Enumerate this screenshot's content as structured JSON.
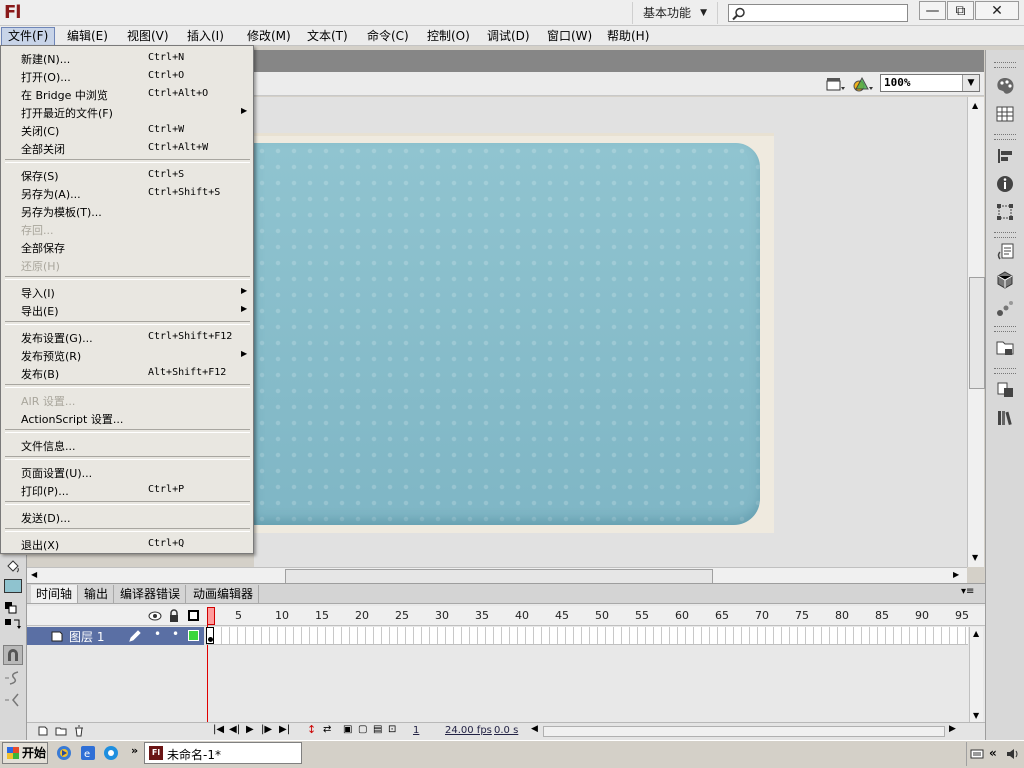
{
  "app": {
    "logo": "Fl",
    "workspace": "基本功能",
    "search": {
      "placeholder": ""
    },
    "window_buttons": {
      "minimize": "—",
      "restore": "⧉",
      "close": "✕"
    }
  },
  "menubar": [
    "文件(F)",
    "编辑(E)",
    "视图(V)",
    "插入(I)",
    "修改(M)",
    "文本(T)",
    "命令(C)",
    "控制(O)",
    "调试(D)",
    "窗口(W)",
    "帮助(H)"
  ],
  "file_menu": [
    {
      "label": "新建(N)...",
      "shortcut": "Ctrl+N"
    },
    {
      "label": "打开(O)...",
      "shortcut": "Ctrl+O"
    },
    {
      "label": "在 Bridge 中浏览",
      "shortcut": "Ctrl+Alt+O"
    },
    {
      "label": "打开最近的文件(F)",
      "submenu": true
    },
    {
      "label": "关闭(C)",
      "shortcut": "Ctrl+W"
    },
    {
      "label": "全部关闭",
      "shortcut": "Ctrl+Alt+W"
    },
    {
      "separator": true
    },
    {
      "label": "保存(S)",
      "shortcut": "Ctrl+S"
    },
    {
      "label": "另存为(A)...",
      "shortcut": "Ctrl+Shift+S"
    },
    {
      "label": "另存为模板(T)..."
    },
    {
      "label": "存回...",
      "disabled": true
    },
    {
      "label": "全部保存"
    },
    {
      "label": "还原(H)",
      "disabled": true
    },
    {
      "separator": true
    },
    {
      "label": "导入(I)",
      "submenu": true
    },
    {
      "label": "导出(E)",
      "submenu": true
    },
    {
      "separator": true
    },
    {
      "label": "发布设置(G)...",
      "shortcut": "Ctrl+Shift+F12"
    },
    {
      "label": "发布预览(R)",
      "submenu": true
    },
    {
      "label": "发布(B)",
      "shortcut": "Alt+Shift+F12"
    },
    {
      "separator": true
    },
    {
      "label": "AIR 设置...",
      "disabled": true
    },
    {
      "label": "ActionScript 设置..."
    },
    {
      "separator": true
    },
    {
      "label": "文件信息..."
    },
    {
      "separator": true
    },
    {
      "label": "页面设置(U)..."
    },
    {
      "label": "打印(P)...",
      "shortcut": "Ctrl+P"
    },
    {
      "separator": true
    },
    {
      "label": "发送(D)..."
    },
    {
      "separator": true
    },
    {
      "label": "退出(X)",
      "shortcut": "Ctrl+Q"
    }
  ],
  "stage": {
    "zoom": "100%"
  },
  "timeline": {
    "tabs": [
      "时间轴",
      "输出",
      "编译器错误",
      "动画编辑器"
    ],
    "frame_numbers": [
      "1",
      "5",
      "10",
      "15",
      "20",
      "25",
      "30",
      "35",
      "40",
      "45",
      "50",
      "55",
      "60",
      "65",
      "70",
      "75",
      "80",
      "85",
      "90",
      "95"
    ],
    "layer": {
      "name": "图层 1"
    },
    "footer": {
      "current_frame": "1",
      "fps": "24.00 fps",
      "time": "0.0 s"
    }
  },
  "taskbar": {
    "start": "开始",
    "task": "未命名-1*"
  }
}
